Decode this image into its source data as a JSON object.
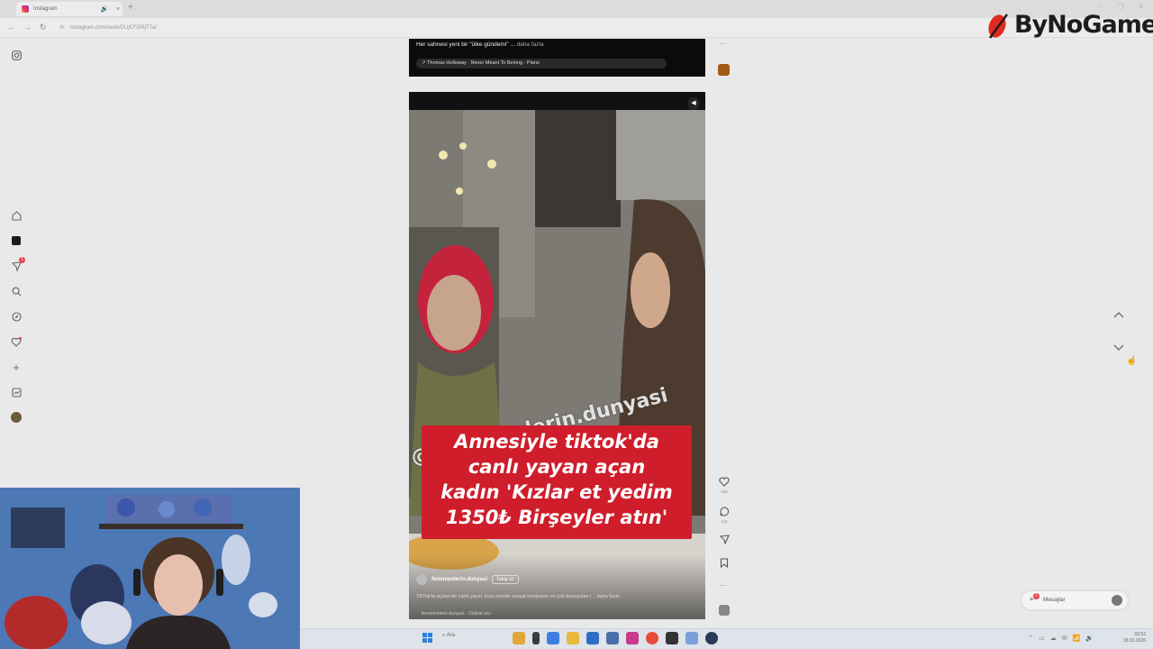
{
  "browser": {
    "tab_title": "Instagram",
    "url": "instagram.com/reels/DUjCFORjT7a/",
    "new_tab_symbol": "+",
    "tab_close": "×",
    "tab_mute": "🔊"
  },
  "overlay": {
    "brand_name": "ByNoGame"
  },
  "sidebar": {
    "notification_count": "1",
    "items": [
      {
        "name": "instagram-logo-icon"
      },
      {
        "name": "home-icon"
      },
      {
        "name": "reels-icon"
      },
      {
        "name": "messages-icon"
      },
      {
        "name": "search-icon"
      },
      {
        "name": "explore-icon"
      },
      {
        "name": "notifications-icon"
      },
      {
        "name": "create-icon"
      },
      {
        "name": "dashboard-icon"
      },
      {
        "name": "profile-avatar"
      }
    ]
  },
  "previous_post": {
    "caption": "Her sahnesi yeni bir \"ülke gündemi\" ...",
    "more": " daha fazla",
    "music": "↗ Thomas Holloway · Never Meant To Belong · Piano"
  },
  "reel": {
    "watermark": "@fenomenlerin.dunyasi",
    "headline": [
      "Annesiyle tiktok'da",
      "canlı yayan açan",
      "kadın 'Kızlar et yedim",
      "1350₺ Birşeyler atın'"
    ],
    "author": "fenomenlerin.dunyasi",
    "follow_label": "Takip Et",
    "caption": "TikTok'ta açılan bir canlı yayın, kısa sürede sosyal medyanın en çok konuşulan i... daha fazla",
    "music": "fenomenlerin.dunyasi · Orijinal ses",
    "like_count": "189",
    "comment_count": "141"
  },
  "messages": {
    "label": "Mesajlar",
    "badge": "1"
  },
  "taskbar": {
    "search_placeholder": "Ara",
    "time": "02:53",
    "date": "18.02.2026"
  },
  "colors": {
    "headline_bg": "#cf1d2b",
    "notification_red": "#e94154",
    "brand_red": "#e02a22"
  }
}
